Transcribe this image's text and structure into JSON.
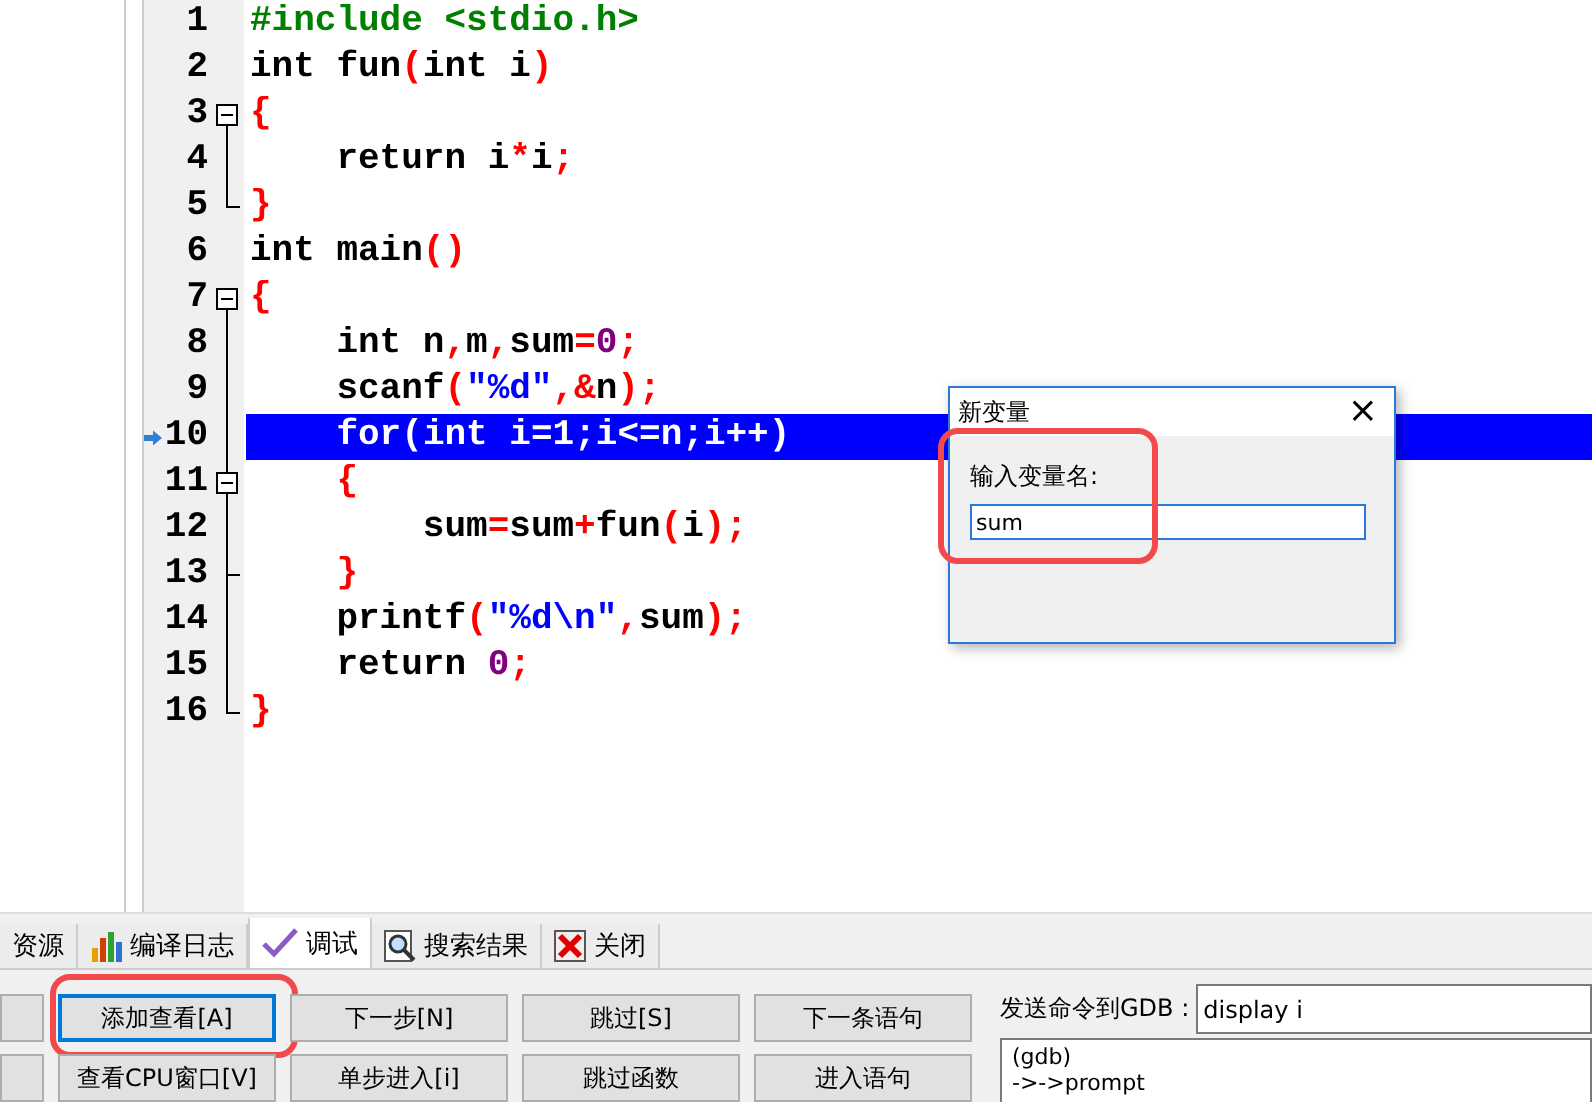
{
  "code": {
    "lines": [
      {
        "number": "1",
        "kind": "plain",
        "current": false,
        "tokens": [
          {
            "kind": "pre",
            "text": "#include <stdio.h>"
          }
        ]
      },
      {
        "number": "2",
        "kind": "plain",
        "current": false,
        "tokens": [
          {
            "kind": "id",
            "text": "int fun"
          },
          {
            "kind": "op",
            "text": "("
          },
          {
            "kind": "id",
            "text": "int i"
          },
          {
            "kind": "op",
            "text": ")"
          }
        ]
      },
      {
        "number": "3",
        "kind": "open",
        "current": false,
        "tokens": [
          {
            "kind": "op",
            "text": "{"
          }
        ]
      },
      {
        "number": "4",
        "kind": "body",
        "current": false,
        "tokens": [
          {
            "kind": "id",
            "text": "    return i"
          },
          {
            "kind": "op",
            "text": "*"
          },
          {
            "kind": "id",
            "text": "i"
          },
          {
            "kind": "op",
            "text": ";"
          }
        ]
      },
      {
        "number": "5",
        "kind": "close",
        "current": false,
        "tokens": [
          {
            "kind": "op",
            "text": "}"
          }
        ]
      },
      {
        "number": "6",
        "kind": "plain",
        "current": false,
        "tokens": [
          {
            "kind": "id",
            "text": "int main"
          },
          {
            "kind": "op",
            "text": "()"
          }
        ]
      },
      {
        "number": "7",
        "kind": "open",
        "current": false,
        "tokens": [
          {
            "kind": "op",
            "text": "{"
          }
        ]
      },
      {
        "number": "8",
        "kind": "body",
        "current": false,
        "tokens": [
          {
            "kind": "id",
            "text": "    int n"
          },
          {
            "kind": "op",
            "text": ","
          },
          {
            "kind": "id",
            "text": "m"
          },
          {
            "kind": "op",
            "text": ","
          },
          {
            "kind": "id",
            "text": "sum"
          },
          {
            "kind": "op",
            "text": "="
          },
          {
            "kind": "num",
            "text": "0"
          },
          {
            "kind": "op",
            "text": ";"
          }
        ]
      },
      {
        "number": "9",
        "kind": "body",
        "current": false,
        "tokens": [
          {
            "kind": "id",
            "text": "    scanf"
          },
          {
            "kind": "op",
            "text": "("
          },
          {
            "kind": "str",
            "text": "\"%d\""
          },
          {
            "kind": "op",
            "text": ",&"
          },
          {
            "kind": "id",
            "text": "n"
          },
          {
            "kind": "op",
            "text": ");"
          }
        ]
      },
      {
        "number": "10",
        "kind": "body",
        "current": true,
        "tokens": [
          {
            "kind": "id",
            "text": "    for"
          },
          {
            "kind": "op",
            "text": "("
          },
          {
            "kind": "id",
            "text": "int i"
          },
          {
            "kind": "op",
            "text": "="
          },
          {
            "kind": "num",
            "text": "1"
          },
          {
            "kind": "op",
            "text": ";"
          },
          {
            "kind": "id",
            "text": "i"
          },
          {
            "kind": "op",
            "text": "<="
          },
          {
            "kind": "id",
            "text": "n"
          },
          {
            "kind": "op",
            "text": ";"
          },
          {
            "kind": "id",
            "text": "i"
          },
          {
            "kind": "op",
            "text": "++)"
          }
        ]
      },
      {
        "number": "11",
        "kind": "inner",
        "current": false,
        "tokens": [
          {
            "kind": "op",
            "text": "    {"
          }
        ]
      },
      {
        "number": "12",
        "kind": "body",
        "current": false,
        "tokens": [
          {
            "kind": "id",
            "text": "        sum"
          },
          {
            "kind": "op",
            "text": "="
          },
          {
            "kind": "id",
            "text": "sum"
          },
          {
            "kind": "op",
            "text": "+"
          },
          {
            "kind": "id",
            "text": "fun"
          },
          {
            "kind": "op",
            "text": "("
          },
          {
            "kind": "id",
            "text": "i"
          },
          {
            "kind": "op",
            "text": ");"
          }
        ]
      },
      {
        "number": "13",
        "kind": "branch",
        "current": false,
        "tokens": [
          {
            "kind": "op",
            "text": "    }"
          }
        ]
      },
      {
        "number": "14",
        "kind": "body",
        "current": false,
        "tokens": [
          {
            "kind": "id",
            "text": "    printf"
          },
          {
            "kind": "op",
            "text": "("
          },
          {
            "kind": "str",
            "text": "\"%d\\n\""
          },
          {
            "kind": "op",
            "text": ","
          },
          {
            "kind": "id",
            "text": "sum"
          },
          {
            "kind": "op",
            "text": ");"
          }
        ]
      },
      {
        "number": "15",
        "kind": "body",
        "current": false,
        "tokens": [
          {
            "kind": "id",
            "text": "    return "
          },
          {
            "kind": "num",
            "text": "0"
          },
          {
            "kind": "op",
            "text": ";"
          }
        ]
      },
      {
        "number": "16",
        "kind": "close",
        "current": false,
        "tokens": [
          {
            "kind": "op",
            "text": "}"
          }
        ]
      }
    ]
  },
  "dialog": {
    "title": "新变量",
    "close": "×",
    "label": "输入变量名:",
    "value": "sum",
    "annotated": true
  },
  "tabs": [
    {
      "label": "资源",
      "kind": "plain",
      "selected": false
    },
    {
      "label": "编译日志",
      "kind": "chart",
      "selected": false
    },
    {
      "label": "调试",
      "kind": "check",
      "selected": true
    },
    {
      "label": "搜索结果",
      "kind": "search",
      "selected": false
    },
    {
      "label": "关闭",
      "kind": "close",
      "selected": false
    }
  ],
  "buttons": [
    [
      {
        "kind": "clipped"
      },
      {
        "kind": "normal",
        "label": "添加查看[A]",
        "focused": true,
        "annotated": true
      },
      {
        "kind": "normal",
        "label": "下一步[N]",
        "focused": false,
        "annotated": false
      },
      {
        "kind": "normal",
        "label": "跳过[S]",
        "focused": false,
        "annotated": false
      },
      {
        "kind": "normal",
        "label": "下一条语句",
        "focused": false,
        "annotated": false
      }
    ],
    [
      {
        "kind": "clipped"
      },
      {
        "kind": "normal",
        "label": "查看CPU窗口[V]",
        "focused": false,
        "annotated": false
      },
      {
        "kind": "normal",
        "label": "单步进入[i]",
        "focused": false,
        "annotated": false
      },
      {
        "kind": "normal",
        "label": "跳过函数",
        "focused": false,
        "annotated": false
      },
      {
        "kind": "normal",
        "label": "进入语句",
        "focused": false,
        "annotated": false
      }
    ]
  ],
  "gdb": {
    "label": "发送命令到GDB :",
    "command": "display i",
    "output": [
      "(gdb)",
      "->->prompt"
    ]
  }
}
